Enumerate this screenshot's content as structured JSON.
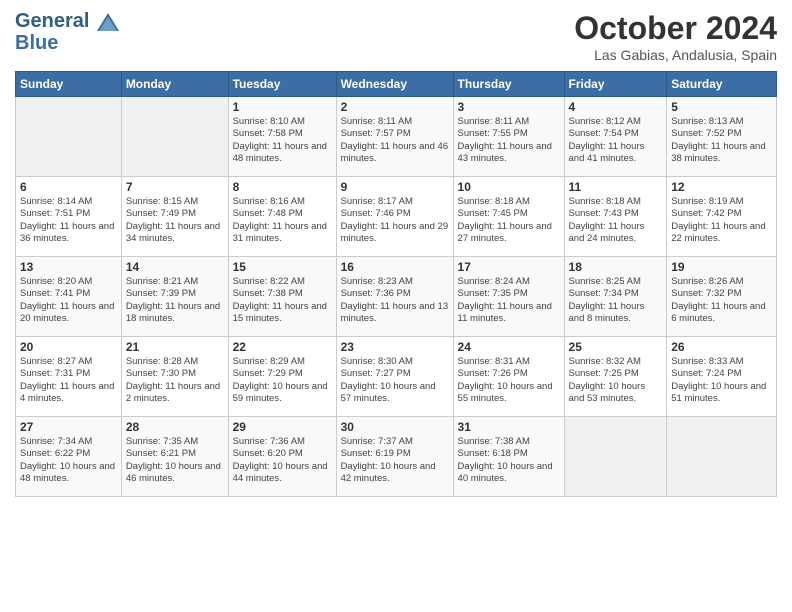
{
  "header": {
    "logo_line1": "General",
    "logo_line2": "Blue",
    "month": "October 2024",
    "location": "Las Gabias, Andalusia, Spain"
  },
  "weekdays": [
    "Sunday",
    "Monday",
    "Tuesday",
    "Wednesday",
    "Thursday",
    "Friday",
    "Saturday"
  ],
  "weeks": [
    [
      {
        "day": "",
        "info": ""
      },
      {
        "day": "",
        "info": ""
      },
      {
        "day": "1",
        "info": "Sunrise: 8:10 AM\nSunset: 7:58 PM\nDaylight: 11 hours and 48 minutes."
      },
      {
        "day": "2",
        "info": "Sunrise: 8:11 AM\nSunset: 7:57 PM\nDaylight: 11 hours and 46 minutes."
      },
      {
        "day": "3",
        "info": "Sunrise: 8:11 AM\nSunset: 7:55 PM\nDaylight: 11 hours and 43 minutes."
      },
      {
        "day": "4",
        "info": "Sunrise: 8:12 AM\nSunset: 7:54 PM\nDaylight: 11 hours and 41 minutes."
      },
      {
        "day": "5",
        "info": "Sunrise: 8:13 AM\nSunset: 7:52 PM\nDaylight: 11 hours and 38 minutes."
      }
    ],
    [
      {
        "day": "6",
        "info": "Sunrise: 8:14 AM\nSunset: 7:51 PM\nDaylight: 11 hours and 36 minutes."
      },
      {
        "day": "7",
        "info": "Sunrise: 8:15 AM\nSunset: 7:49 PM\nDaylight: 11 hours and 34 minutes."
      },
      {
        "day": "8",
        "info": "Sunrise: 8:16 AM\nSunset: 7:48 PM\nDaylight: 11 hours and 31 minutes."
      },
      {
        "day": "9",
        "info": "Sunrise: 8:17 AM\nSunset: 7:46 PM\nDaylight: 11 hours and 29 minutes."
      },
      {
        "day": "10",
        "info": "Sunrise: 8:18 AM\nSunset: 7:45 PM\nDaylight: 11 hours and 27 minutes."
      },
      {
        "day": "11",
        "info": "Sunrise: 8:18 AM\nSunset: 7:43 PM\nDaylight: 11 hours and 24 minutes."
      },
      {
        "day": "12",
        "info": "Sunrise: 8:19 AM\nSunset: 7:42 PM\nDaylight: 11 hours and 22 minutes."
      }
    ],
    [
      {
        "day": "13",
        "info": "Sunrise: 8:20 AM\nSunset: 7:41 PM\nDaylight: 11 hours and 20 minutes."
      },
      {
        "day": "14",
        "info": "Sunrise: 8:21 AM\nSunset: 7:39 PM\nDaylight: 11 hours and 18 minutes."
      },
      {
        "day": "15",
        "info": "Sunrise: 8:22 AM\nSunset: 7:38 PM\nDaylight: 11 hours and 15 minutes."
      },
      {
        "day": "16",
        "info": "Sunrise: 8:23 AM\nSunset: 7:36 PM\nDaylight: 11 hours and 13 minutes."
      },
      {
        "day": "17",
        "info": "Sunrise: 8:24 AM\nSunset: 7:35 PM\nDaylight: 11 hours and 11 minutes."
      },
      {
        "day": "18",
        "info": "Sunrise: 8:25 AM\nSunset: 7:34 PM\nDaylight: 11 hours and 8 minutes."
      },
      {
        "day": "19",
        "info": "Sunrise: 8:26 AM\nSunset: 7:32 PM\nDaylight: 11 hours and 6 minutes."
      }
    ],
    [
      {
        "day": "20",
        "info": "Sunrise: 8:27 AM\nSunset: 7:31 PM\nDaylight: 11 hours and 4 minutes."
      },
      {
        "day": "21",
        "info": "Sunrise: 8:28 AM\nSunset: 7:30 PM\nDaylight: 11 hours and 2 minutes."
      },
      {
        "day": "22",
        "info": "Sunrise: 8:29 AM\nSunset: 7:29 PM\nDaylight: 10 hours and 59 minutes."
      },
      {
        "day": "23",
        "info": "Sunrise: 8:30 AM\nSunset: 7:27 PM\nDaylight: 10 hours and 57 minutes."
      },
      {
        "day": "24",
        "info": "Sunrise: 8:31 AM\nSunset: 7:26 PM\nDaylight: 10 hours and 55 minutes."
      },
      {
        "day": "25",
        "info": "Sunrise: 8:32 AM\nSunset: 7:25 PM\nDaylight: 10 hours and 53 minutes."
      },
      {
        "day": "26",
        "info": "Sunrise: 8:33 AM\nSunset: 7:24 PM\nDaylight: 10 hours and 51 minutes."
      }
    ],
    [
      {
        "day": "27",
        "info": "Sunrise: 7:34 AM\nSunset: 6:22 PM\nDaylight: 10 hours and 48 minutes."
      },
      {
        "day": "28",
        "info": "Sunrise: 7:35 AM\nSunset: 6:21 PM\nDaylight: 10 hours and 46 minutes."
      },
      {
        "day": "29",
        "info": "Sunrise: 7:36 AM\nSunset: 6:20 PM\nDaylight: 10 hours and 44 minutes."
      },
      {
        "day": "30",
        "info": "Sunrise: 7:37 AM\nSunset: 6:19 PM\nDaylight: 10 hours and 42 minutes."
      },
      {
        "day": "31",
        "info": "Sunrise: 7:38 AM\nSunset: 6:18 PM\nDaylight: 10 hours and 40 minutes."
      },
      {
        "day": "",
        "info": ""
      },
      {
        "day": "",
        "info": ""
      }
    ]
  ]
}
